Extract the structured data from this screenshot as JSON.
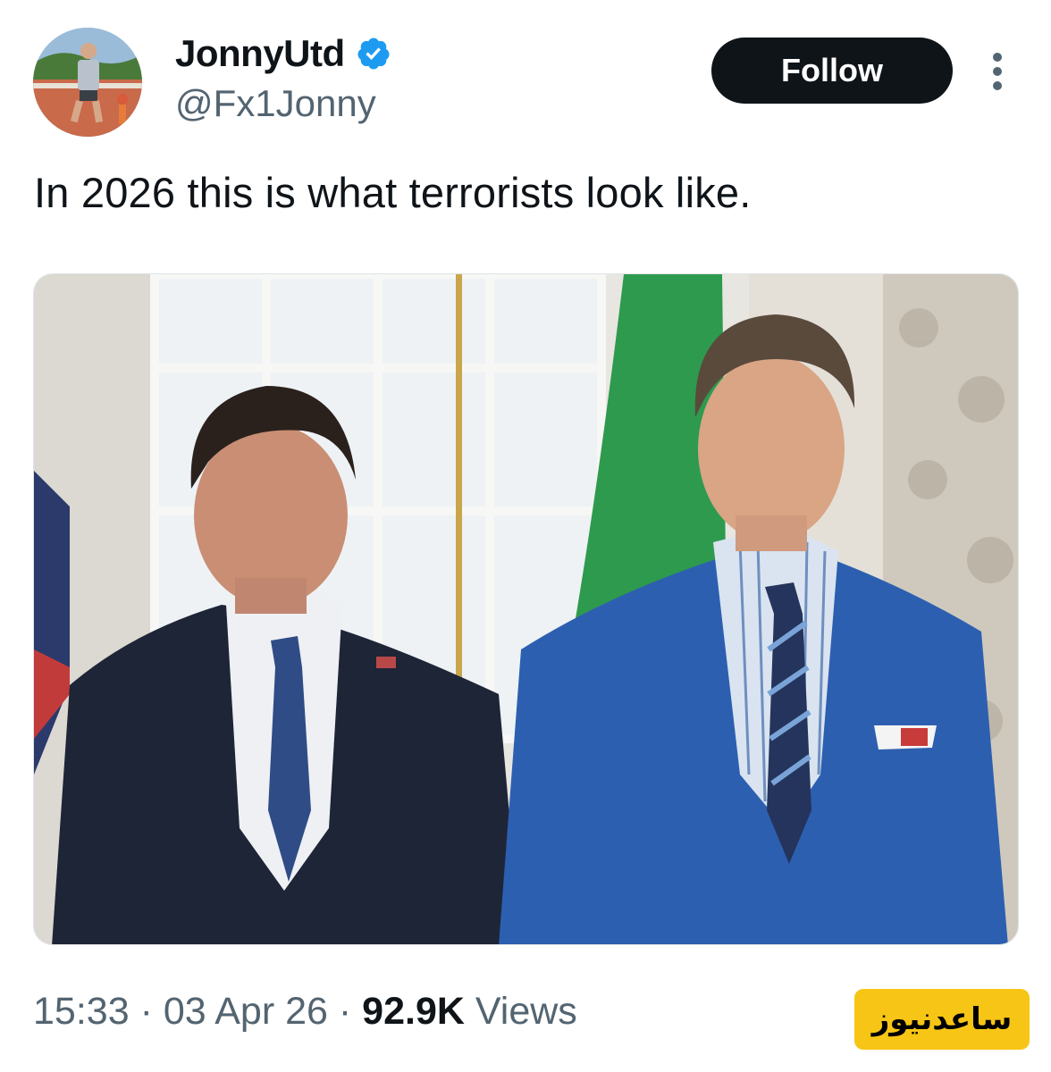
{
  "header": {
    "display_name": "JonnyUtd",
    "handle": "@Fx1Jonny",
    "verified": true,
    "follow_label": "Follow"
  },
  "tweet": {
    "text": "In 2026 this is what terrorists look like."
  },
  "meta": {
    "time": "15:33",
    "separator": "·",
    "date": "03 Apr 26",
    "views_count": "92.9K",
    "views_label": "Views"
  },
  "watermark": {
    "text": "ساعدنیوز"
  },
  "colors": {
    "text_primary": "#0f1419",
    "text_secondary": "#536471",
    "verified_blue": "#1d9bf0",
    "follow_bg": "#0f1419",
    "watermark_bg": "#f7c515"
  },
  "icons": {
    "verified": "verified-badge-icon",
    "more": "more-options-icon"
  }
}
